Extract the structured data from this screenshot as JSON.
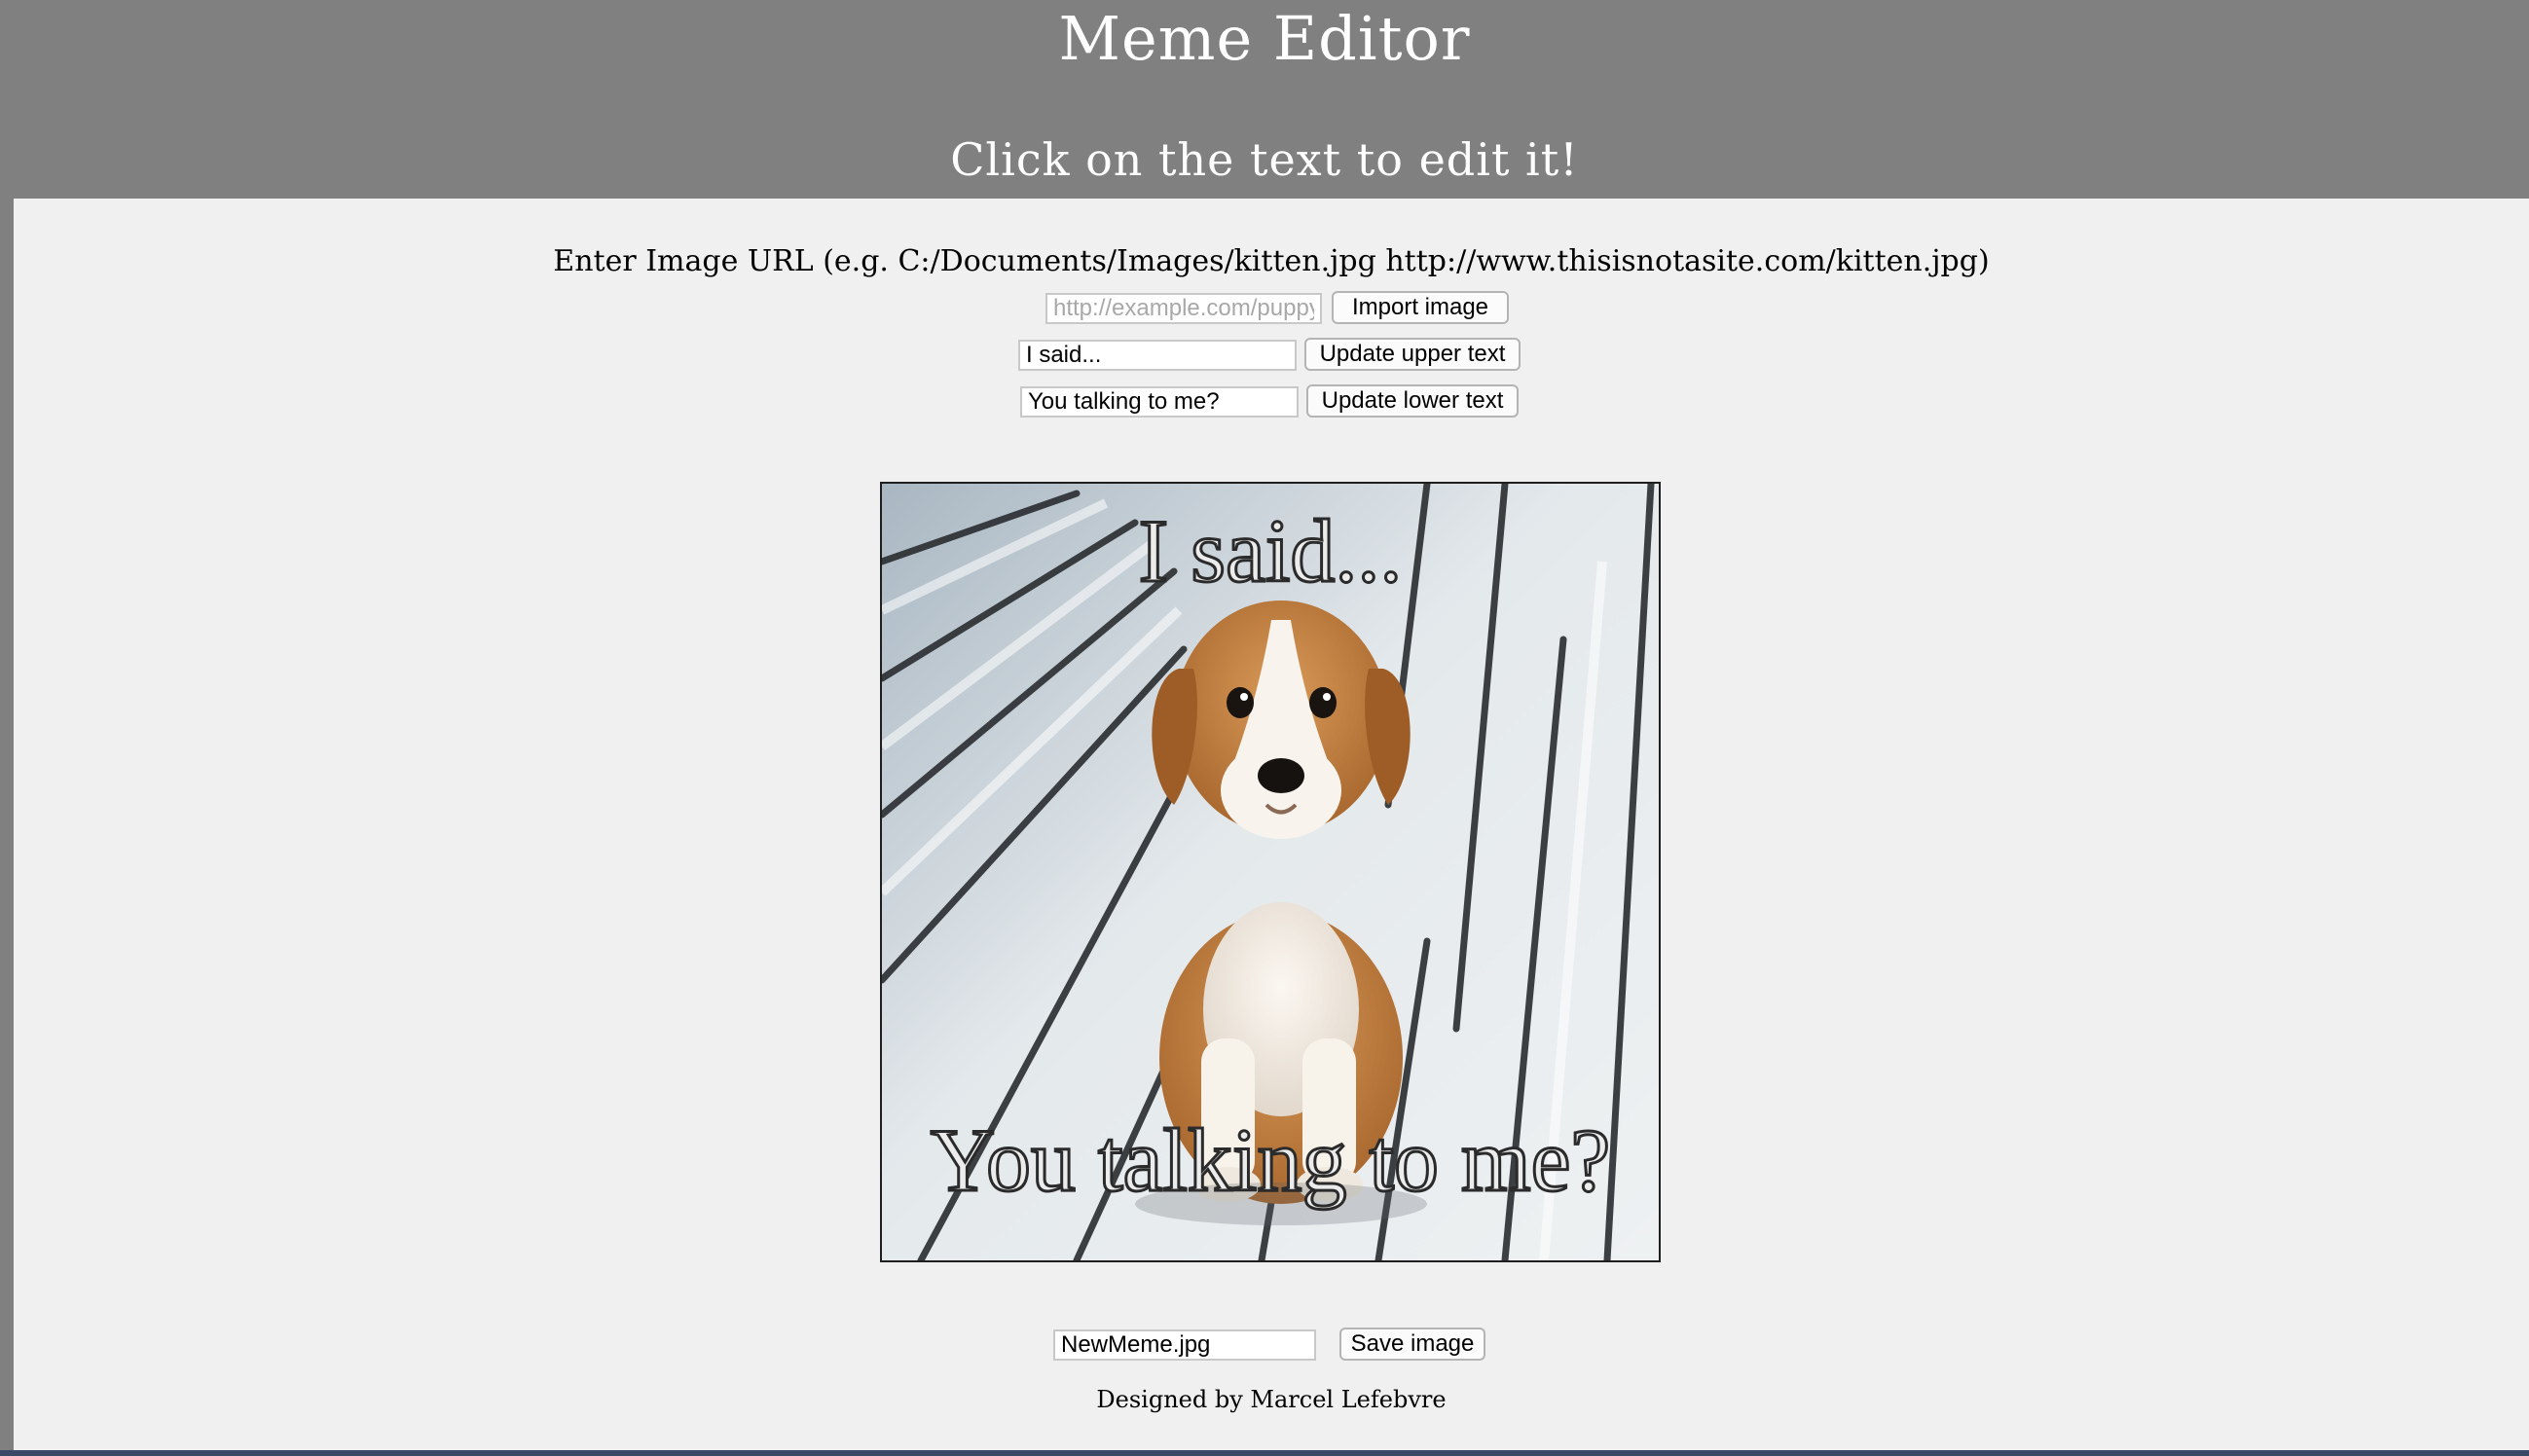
{
  "header": {
    "title": "Meme Editor",
    "subtitle": "Click on the text to edit it!"
  },
  "import": {
    "instruction": "Enter Image URL (e.g. C:/Documents/Images/kitten.jpg http://www.thisisnotasite.com/kitten.jpg)",
    "url_placeholder": "http://example.com/puppy.jpg",
    "url_value": "",
    "button_label": "Import image"
  },
  "upper_text": {
    "value": "I said...",
    "button_label": "Update upper text"
  },
  "lower_text": {
    "value": "You talking to me?",
    "button_label": "Update lower text"
  },
  "meme": {
    "upper_caption": "I said...",
    "lower_caption": "You talking to me?",
    "image_subject": "puppy-on-deck"
  },
  "save": {
    "filename_value": "NewMeme.jpg",
    "button_label": "Save image"
  },
  "footer": {
    "credit": "Designed by Marcel Lefebvre"
  },
  "colors": {
    "header_bg": "#808080",
    "page_bg": "#f0f0f0",
    "header_text": "#ffffff"
  }
}
